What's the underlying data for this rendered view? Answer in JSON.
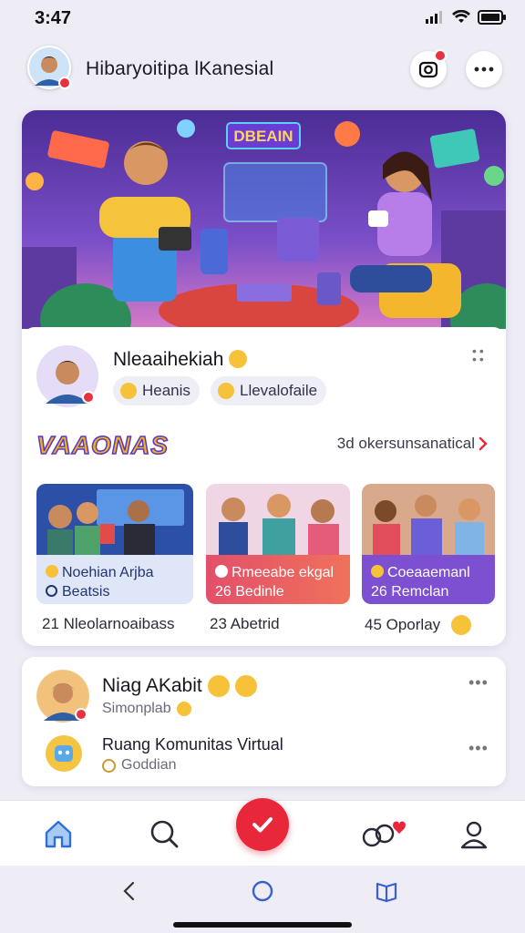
{
  "status": {
    "time": "3:47"
  },
  "header": {
    "title": "Hibaryoitipa lKanesial"
  },
  "hero": {
    "sign_text": "DBEAIN"
  },
  "profile": {
    "name": "Nleaaihekiah",
    "chips": [
      {
        "label": "Heanis"
      },
      {
        "label": "Llevalofaile"
      }
    ]
  },
  "section": {
    "logo_text": "VAAONAS",
    "see_all": "3d okersunsanatical"
  },
  "tiles": [
    {
      "line1": "Noehian Arjba",
      "line2": "Beatsis",
      "caption": "21 Nleolarnoaibass",
      "foot_bg": "#dfe6f8"
    },
    {
      "line1": "Rmeeabe ekgal",
      "line2": "26 Bedinle",
      "caption": "23 Abetrid",
      "foot_bg": "#e2506a"
    },
    {
      "line1": "Coeaaemanl",
      "line2": "26 Remclan",
      "caption": "45 Oporlay",
      "foot_bg": "#7d4fd1"
    }
  ],
  "card2": {
    "name": "Niag AKabit",
    "subtitle": "Simonplab",
    "row_title": "Ruang Komunitas Virtual",
    "row_subtitle": "Goddian"
  },
  "colors": {
    "accent_red": "#e8283a",
    "accent_purple": "#5b36c9",
    "nav_active": "#2f6fd6"
  },
  "icons": {
    "nav": [
      "home-icon",
      "search-icon",
      "check-icon",
      "community-heart-icon",
      "profile-icon"
    ],
    "system": [
      "back-icon",
      "home-circle-icon",
      "book-icon"
    ]
  }
}
